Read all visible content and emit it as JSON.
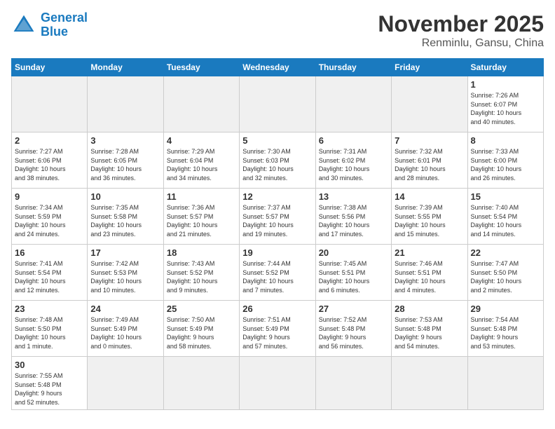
{
  "header": {
    "logo_line1": "General",
    "logo_line2": "Blue",
    "month": "November 2025",
    "location": "Renminlu, Gansu, China"
  },
  "days_of_week": [
    "Sunday",
    "Monday",
    "Tuesday",
    "Wednesday",
    "Thursday",
    "Friday",
    "Saturday"
  ],
  "weeks": [
    [
      {
        "day": "",
        "info": ""
      },
      {
        "day": "",
        "info": ""
      },
      {
        "day": "",
        "info": ""
      },
      {
        "day": "",
        "info": ""
      },
      {
        "day": "",
        "info": ""
      },
      {
        "day": "",
        "info": ""
      },
      {
        "day": "1",
        "info": "Sunrise: 7:26 AM\nSunset: 6:07 PM\nDaylight: 10 hours\nand 40 minutes."
      }
    ],
    [
      {
        "day": "2",
        "info": "Sunrise: 7:27 AM\nSunset: 6:06 PM\nDaylight: 10 hours\nand 38 minutes."
      },
      {
        "day": "3",
        "info": "Sunrise: 7:28 AM\nSunset: 6:05 PM\nDaylight: 10 hours\nand 36 minutes."
      },
      {
        "day": "4",
        "info": "Sunrise: 7:29 AM\nSunset: 6:04 PM\nDaylight: 10 hours\nand 34 minutes."
      },
      {
        "day": "5",
        "info": "Sunrise: 7:30 AM\nSunset: 6:03 PM\nDaylight: 10 hours\nand 32 minutes."
      },
      {
        "day": "6",
        "info": "Sunrise: 7:31 AM\nSunset: 6:02 PM\nDaylight: 10 hours\nand 30 minutes."
      },
      {
        "day": "7",
        "info": "Sunrise: 7:32 AM\nSunset: 6:01 PM\nDaylight: 10 hours\nand 28 minutes."
      },
      {
        "day": "8",
        "info": "Sunrise: 7:33 AM\nSunset: 6:00 PM\nDaylight: 10 hours\nand 26 minutes."
      }
    ],
    [
      {
        "day": "9",
        "info": "Sunrise: 7:34 AM\nSunset: 5:59 PM\nDaylight: 10 hours\nand 24 minutes."
      },
      {
        "day": "10",
        "info": "Sunrise: 7:35 AM\nSunset: 5:58 PM\nDaylight: 10 hours\nand 23 minutes."
      },
      {
        "day": "11",
        "info": "Sunrise: 7:36 AM\nSunset: 5:57 PM\nDaylight: 10 hours\nand 21 minutes."
      },
      {
        "day": "12",
        "info": "Sunrise: 7:37 AM\nSunset: 5:57 PM\nDaylight: 10 hours\nand 19 minutes."
      },
      {
        "day": "13",
        "info": "Sunrise: 7:38 AM\nSunset: 5:56 PM\nDaylight: 10 hours\nand 17 minutes."
      },
      {
        "day": "14",
        "info": "Sunrise: 7:39 AM\nSunset: 5:55 PM\nDaylight: 10 hours\nand 15 minutes."
      },
      {
        "day": "15",
        "info": "Sunrise: 7:40 AM\nSunset: 5:54 PM\nDaylight: 10 hours\nand 14 minutes."
      }
    ],
    [
      {
        "day": "16",
        "info": "Sunrise: 7:41 AM\nSunset: 5:54 PM\nDaylight: 10 hours\nand 12 minutes."
      },
      {
        "day": "17",
        "info": "Sunrise: 7:42 AM\nSunset: 5:53 PM\nDaylight: 10 hours\nand 10 minutes."
      },
      {
        "day": "18",
        "info": "Sunrise: 7:43 AM\nSunset: 5:52 PM\nDaylight: 10 hours\nand 9 minutes."
      },
      {
        "day": "19",
        "info": "Sunrise: 7:44 AM\nSunset: 5:52 PM\nDaylight: 10 hours\nand 7 minutes."
      },
      {
        "day": "20",
        "info": "Sunrise: 7:45 AM\nSunset: 5:51 PM\nDaylight: 10 hours\nand 6 minutes."
      },
      {
        "day": "21",
        "info": "Sunrise: 7:46 AM\nSunset: 5:51 PM\nDaylight: 10 hours\nand 4 minutes."
      },
      {
        "day": "22",
        "info": "Sunrise: 7:47 AM\nSunset: 5:50 PM\nDaylight: 10 hours\nand 2 minutes."
      }
    ],
    [
      {
        "day": "23",
        "info": "Sunrise: 7:48 AM\nSunset: 5:50 PM\nDaylight: 10 hours\nand 1 minute."
      },
      {
        "day": "24",
        "info": "Sunrise: 7:49 AM\nSunset: 5:49 PM\nDaylight: 10 hours\nand 0 minutes."
      },
      {
        "day": "25",
        "info": "Sunrise: 7:50 AM\nSunset: 5:49 PM\nDaylight: 9 hours\nand 58 minutes."
      },
      {
        "day": "26",
        "info": "Sunrise: 7:51 AM\nSunset: 5:49 PM\nDaylight: 9 hours\nand 57 minutes."
      },
      {
        "day": "27",
        "info": "Sunrise: 7:52 AM\nSunset: 5:48 PM\nDaylight: 9 hours\nand 56 minutes."
      },
      {
        "day": "28",
        "info": "Sunrise: 7:53 AM\nSunset: 5:48 PM\nDaylight: 9 hours\nand 54 minutes."
      },
      {
        "day": "29",
        "info": "Sunrise: 7:54 AM\nSunset: 5:48 PM\nDaylight: 9 hours\nand 53 minutes."
      }
    ],
    [
      {
        "day": "30",
        "info": "Sunrise: 7:55 AM\nSunset: 5:48 PM\nDaylight: 9 hours\nand 52 minutes."
      },
      {
        "day": "",
        "info": ""
      },
      {
        "day": "",
        "info": ""
      },
      {
        "day": "",
        "info": ""
      },
      {
        "day": "",
        "info": ""
      },
      {
        "day": "",
        "info": ""
      },
      {
        "day": "",
        "info": ""
      }
    ]
  ]
}
